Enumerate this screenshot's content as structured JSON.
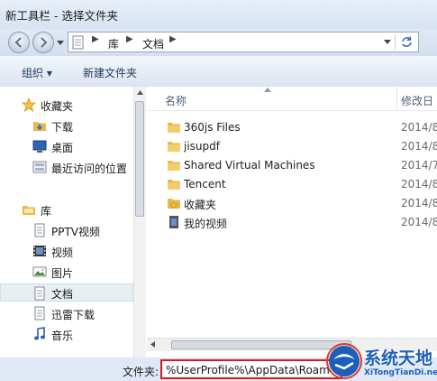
{
  "window": {
    "title": "新工具栏 - 选择文件夹"
  },
  "address": {
    "crumbs": [
      "库",
      "文档"
    ]
  },
  "toolbar": {
    "organize_label": "组织 ▾",
    "new_folder_label": "新建文件夹"
  },
  "nav": {
    "favorites": {
      "label": "收藏夹",
      "items": [
        "下载",
        "桌面",
        "最近访问的位置"
      ]
    },
    "libraries": {
      "label": "库",
      "items": [
        "PPTV视频",
        "视频",
        "图片",
        "文档",
        "迅雷下载",
        "音乐"
      ]
    },
    "selected": "文档"
  },
  "files": {
    "columns": {
      "name": "名称",
      "modified": "修改日"
    },
    "rows": [
      {
        "name": "360js Files",
        "date": "2014/8/",
        "icon": "folder-icon"
      },
      {
        "name": "jisupdf",
        "date": "2014/8/",
        "icon": "folder-icon"
      },
      {
        "name": "Shared Virtual Machines",
        "date": "2014/7/",
        "icon": "folder-icon"
      },
      {
        "name": "Tencent",
        "date": "2014/8/",
        "icon": "folder-icon"
      },
      {
        "name": "收藏夹",
        "date": "2014/8/",
        "icon": "star-folder-icon"
      },
      {
        "name": "我的视频",
        "date": "2014/8/",
        "icon": "video-folder-icon"
      }
    ]
  },
  "footer": {
    "folder_label": "文件夹:",
    "folder_value": "%UserProfile%\\AppData\\Roam"
  },
  "watermark": {
    "brand": "系统天地",
    "url": "XiTongTianDi.net"
  },
  "colors": {
    "highlight_border": "#d9171c",
    "folder": "#e8b84a"
  }
}
